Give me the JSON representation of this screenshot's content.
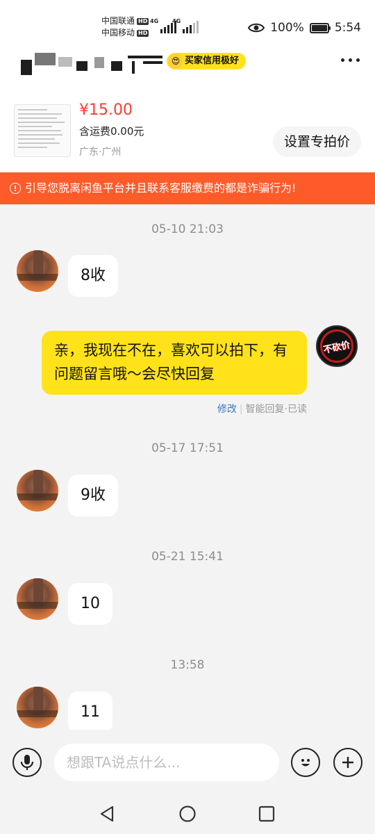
{
  "status_bar": {
    "carrier1": "中国联通",
    "carrier2": "中国移动",
    "hd": "HD",
    "network": "4G",
    "battery": "100%",
    "battery_level": 1.0,
    "time": "5:54"
  },
  "header": {
    "credit_badge": "买家信用极好",
    "more_icon": "more-dots-icon"
  },
  "product": {
    "price": "¥15.00",
    "shipping": "含运费0.00元",
    "location": "广东·广州",
    "set_price_button": "设置专拍价"
  },
  "warning": {
    "icon": "!",
    "text": "引导您脱离闲鱼平台并且联系客服缴费的都是诈骗行为!"
  },
  "messages": [
    {
      "timestamp": "05-10 21:03",
      "incoming": "8收"
    },
    {
      "outgoing": "亲，我现在不在，喜欢可以拍下，有问题留言哦～会尽快回复",
      "edit_label": "修改",
      "meta": "智能回复·已读",
      "my_avatar_text": "不砍价"
    },
    {
      "timestamp": "05-17 17:51",
      "incoming": "9收"
    },
    {
      "timestamp": "05-21 15:41",
      "incoming": "10"
    },
    {
      "timestamp": "13:58",
      "incoming": "11"
    }
  ],
  "input_bar": {
    "voice_icon": "microphone-icon",
    "placeholder": "想跟TA说点什么...",
    "emoji_icon": "emoji-icon",
    "plus_icon": "plus-icon"
  },
  "nav_bar": {
    "back": "back-icon",
    "home": "home-icon",
    "recents": "recents-icon"
  }
}
